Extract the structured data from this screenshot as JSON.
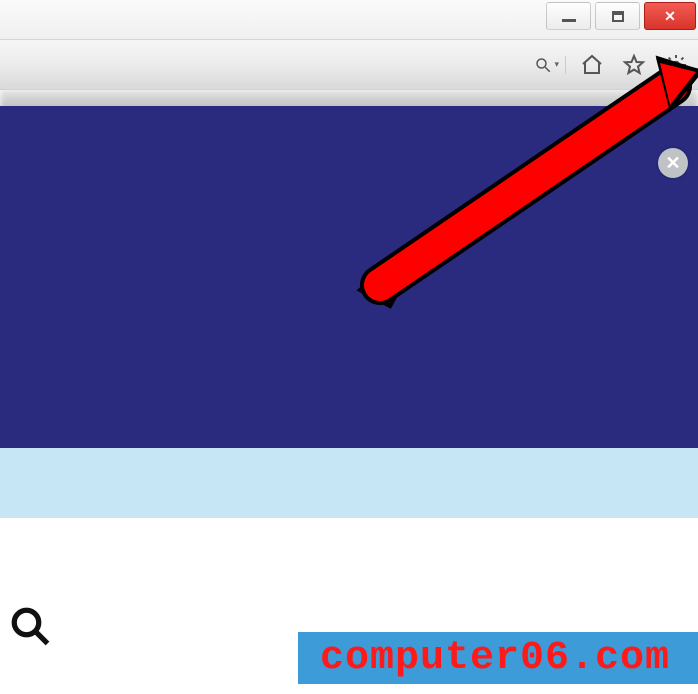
{
  "window_controls": {
    "minimize_glyph": "–",
    "maximize_glyph": "❐",
    "close_glyph": "✕"
  },
  "toolbar": {
    "search_dropdown_glyph": "▾"
  },
  "panel_close_glyph": "✕",
  "watermark_text": "computer06.com",
  "colors": {
    "dark_panel": "#2a2a7f",
    "light_band": "#c6e6f5",
    "watermark_bg": "#3d9bd7",
    "watermark_text": "#ff1a1a",
    "close_button": "#d9342b",
    "arrow": "#ff0000"
  }
}
